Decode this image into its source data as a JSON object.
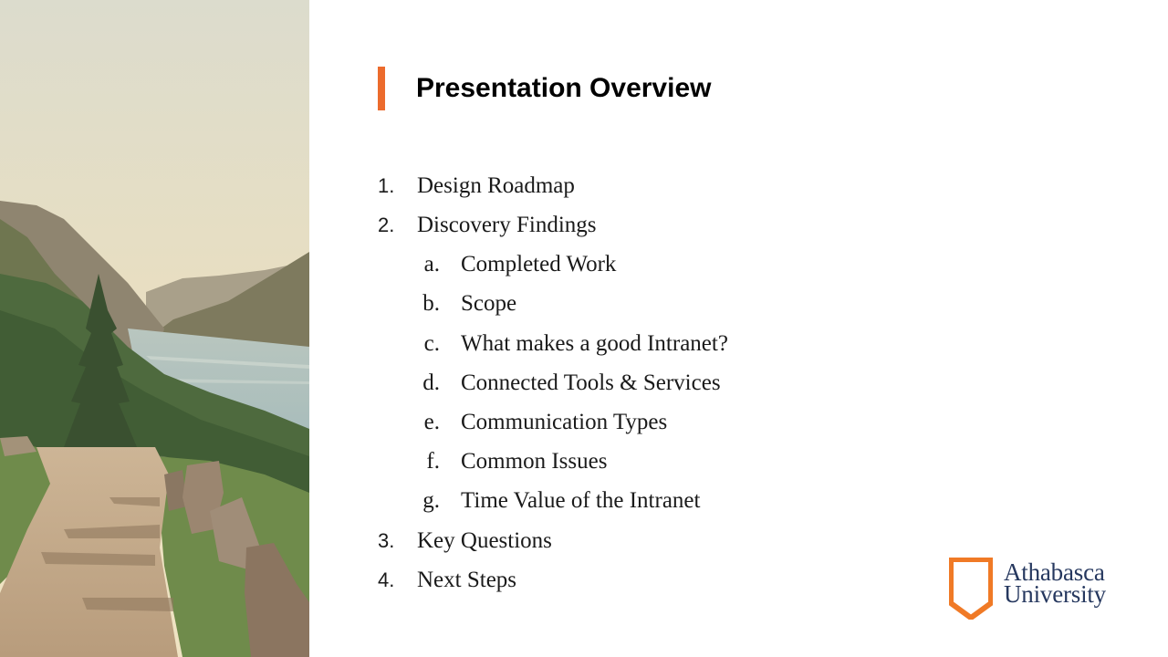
{
  "slide": {
    "title": "Presentation Overview",
    "accent_color": "#ec6b2d",
    "photo_description": "Vintage tinted photograph of a dirt mountain road beside a fjord with forested hills"
  },
  "agenda": [
    {
      "marker": "1.",
      "label": "Design Roadmap",
      "level": 1
    },
    {
      "marker": "2.",
      "label": "Discovery Findings",
      "level": 1
    },
    {
      "marker": "a.",
      "label": "Completed Work",
      "level": 2
    },
    {
      "marker": "b.",
      "label": "Scope",
      "level": 2
    },
    {
      "marker": "c.",
      "label": "What makes a good Intranet?",
      "level": 2
    },
    {
      "marker": "d.",
      "label": "Connected Tools & Services",
      "level": 2
    },
    {
      "marker": "e.",
      "label": "Communication Types",
      "level": 2
    },
    {
      "marker": "f.",
      "label": "Common Issues",
      "level": 2
    },
    {
      "marker": "g.",
      "label": "Time Value of the Intranet",
      "level": 2
    },
    {
      "marker": "3.",
      "label": "Key Questions",
      "level": 1
    },
    {
      "marker": "4.",
      "label": "Next Steps",
      "level": 1
    }
  ],
  "logo": {
    "line1": "Athabasca",
    "line2": "University",
    "shield_color": "#f07a26",
    "text_color": "#26385f"
  }
}
